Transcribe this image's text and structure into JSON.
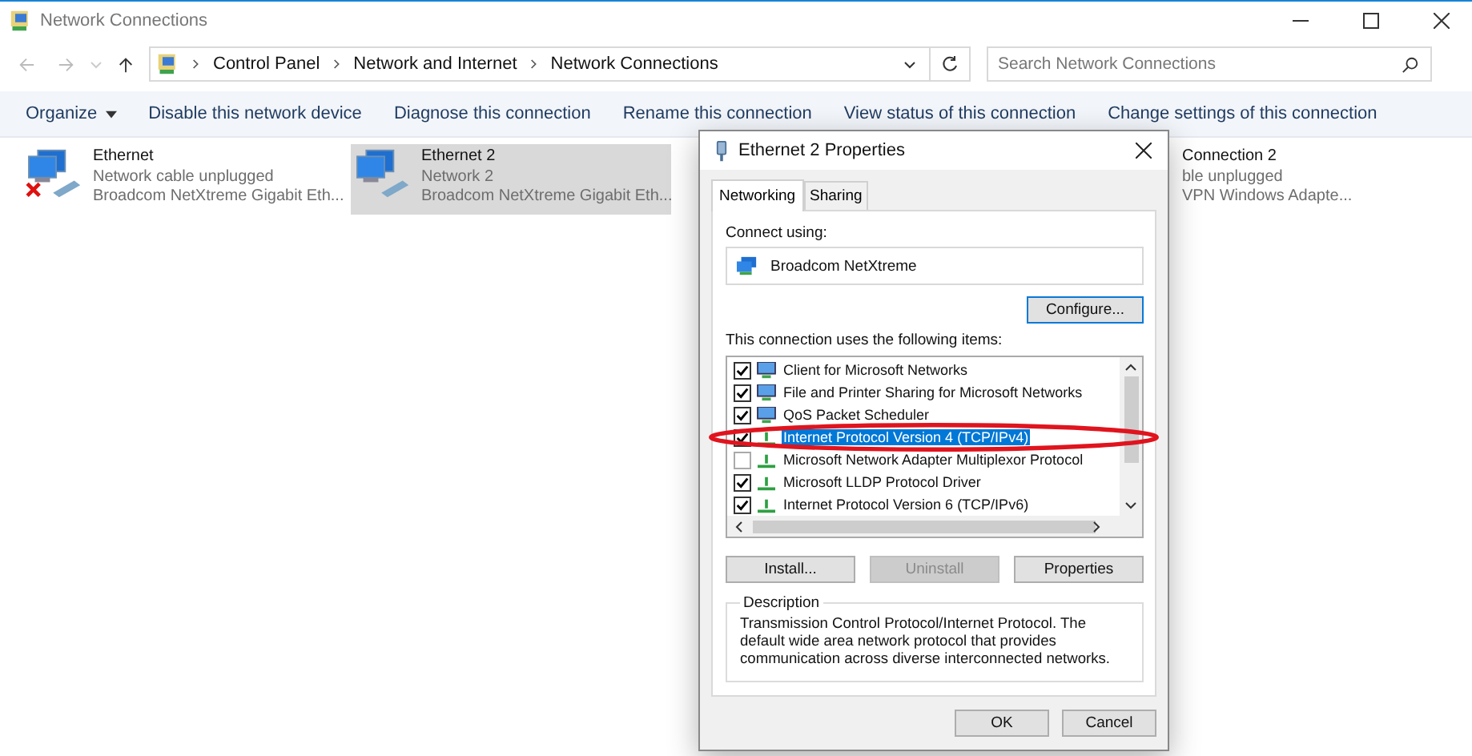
{
  "window": {
    "title": "Network Connections"
  },
  "address": {
    "crumbs": [
      "Control Panel",
      "Network and Internet",
      "Network Connections"
    ],
    "search_placeholder": "Search Network Connections"
  },
  "commands": [
    {
      "label": "Organize",
      "kind": "menu"
    },
    {
      "label": "Disable this network device",
      "kind": "plain"
    },
    {
      "label": "Diagnose this connection",
      "kind": "plain"
    },
    {
      "label": "Rename this connection",
      "kind": "plain"
    },
    {
      "label": "View status of this connection",
      "kind": "plain"
    },
    {
      "label": "Change settings of this connection",
      "kind": "plain"
    }
  ],
  "connections": [
    {
      "name": "Ethernet",
      "status": "Network cable unplugged",
      "device": "Broadcom NetXtreme Gigabit Eth...",
      "unplugged": true,
      "selected": false
    },
    {
      "name": "Ethernet 2",
      "status": "Network 2",
      "device": "Broadcom NetXtreme Gigabit Eth...",
      "unplugged": false,
      "selected": true
    }
  ],
  "partial_connection": {
    "name": "Connection 2",
    "status": "ble unplugged",
    "device": "VPN Windows Adapte..."
  },
  "dialog": {
    "title": "Ethernet 2 Properties",
    "tabs": [
      {
        "label": "Networking",
        "selected": true
      },
      {
        "label": "Sharing",
        "selected": false
      }
    ],
    "connect_using_label": "Connect using:",
    "adapter": "Broadcom NetXtreme",
    "configure": "Configure...",
    "items_label": "This connection uses the following items:",
    "items": [
      {
        "label": "Client for Microsoft Networks",
        "checked": true,
        "selected": false,
        "kind": "client"
      },
      {
        "label": "File and Printer Sharing for Microsoft Networks",
        "checked": true,
        "selected": false,
        "kind": "client"
      },
      {
        "label": "QoS Packet Scheduler",
        "checked": true,
        "selected": false,
        "kind": "client"
      },
      {
        "label": "Internet Protocol Version 4 (TCP/IPv4)",
        "checked": true,
        "selected": true,
        "kind": "protocol"
      },
      {
        "label": "Microsoft Network Adapter Multiplexor Protocol",
        "checked": false,
        "selected": false,
        "kind": "protocol"
      },
      {
        "label": "Microsoft LLDP Protocol Driver",
        "checked": true,
        "selected": false,
        "kind": "protocol"
      },
      {
        "label": "Internet Protocol Version 6 (TCP/IPv6)",
        "checked": true,
        "selected": false,
        "kind": "protocol"
      }
    ],
    "buttons": [
      {
        "label": "Install...",
        "disabled": false
      },
      {
        "label": "Uninstall",
        "disabled": true
      },
      {
        "label": "Properties",
        "disabled": false
      }
    ],
    "description_label": "Description",
    "description": "Transmission Control Protocol/Internet Protocol. The default wide area network protocol that provides communication across diverse interconnected networks.",
    "footer_buttons": [
      "OK",
      "Cancel"
    ]
  }
}
